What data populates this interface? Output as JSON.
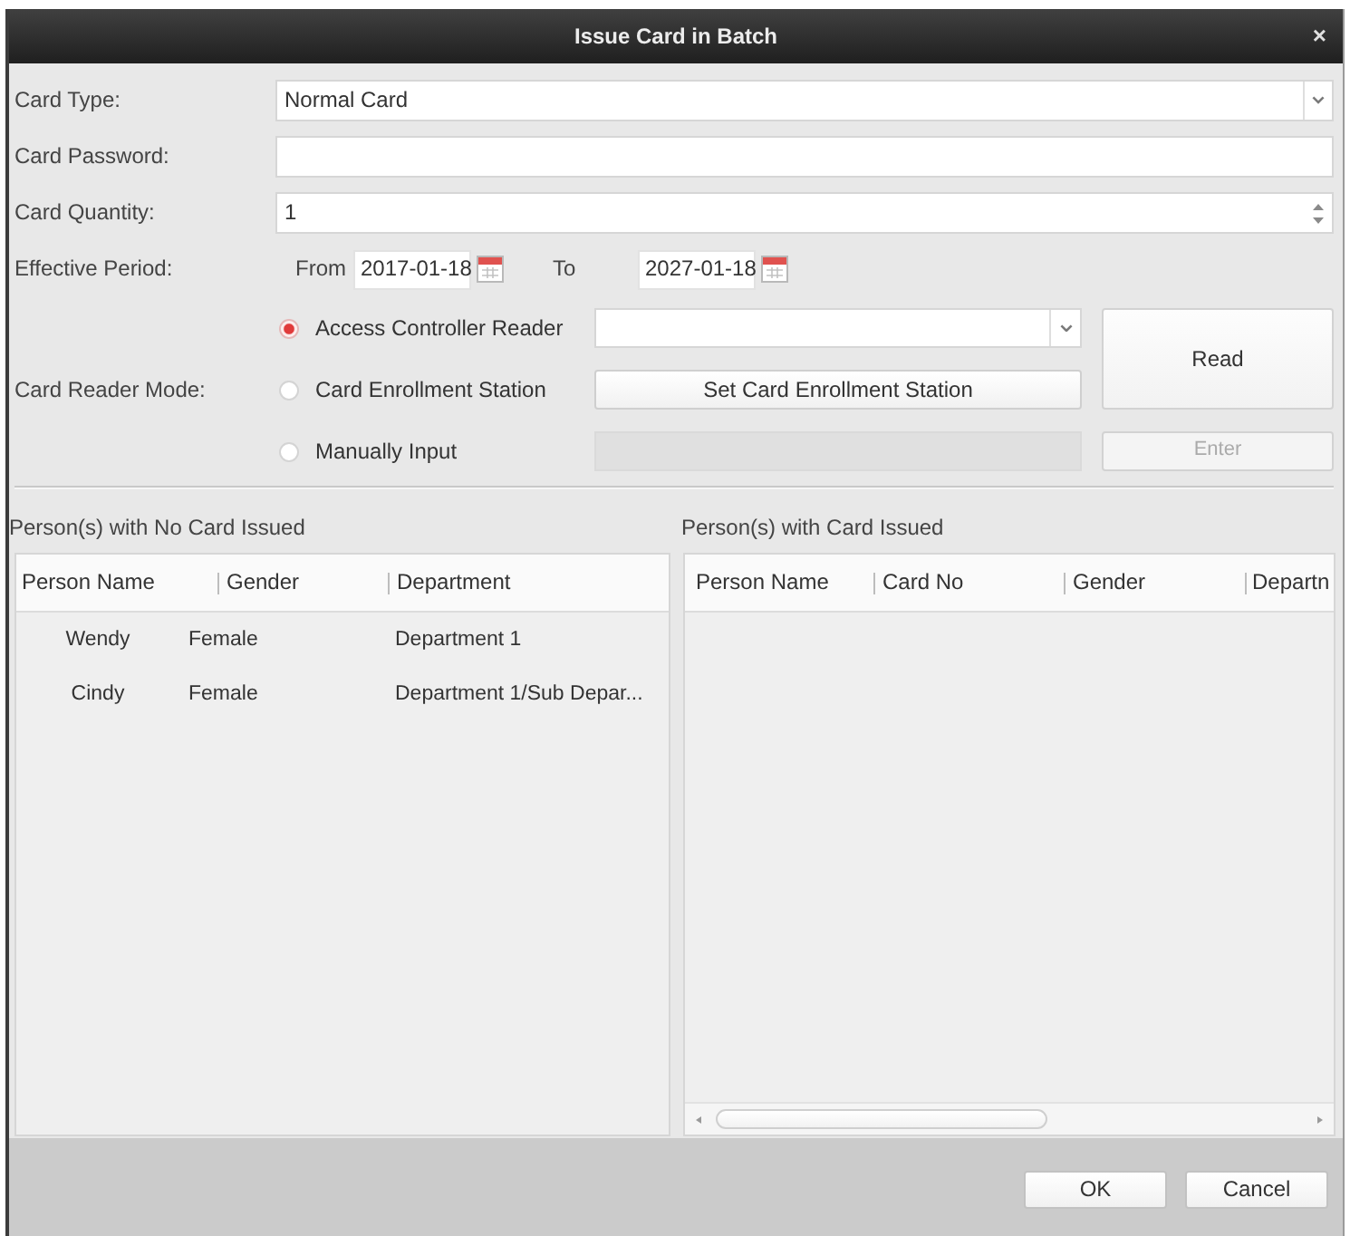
{
  "window": {
    "title": "Issue Card in Batch",
    "close": "×"
  },
  "card_type": {
    "label": "Card Type:",
    "value": "Normal Card"
  },
  "card_password": {
    "label": "Card Password:"
  },
  "card_quantity": {
    "label": "Card Quantity:",
    "value": "1"
  },
  "effective_period": {
    "label": "Effective Period:",
    "from_label": "From",
    "from": "2017-01-18",
    "to_label": "To",
    "to": "2027-01-18"
  },
  "card_reader_mode": {
    "label": "Card Reader Mode:",
    "options": [
      {
        "label": "Access Controller Reader",
        "selected": true,
        "kind": "dropdown"
      },
      {
        "label": "Card Enrollment Station",
        "selected": false,
        "kind": "button",
        "button": "Set Card Enrollment Station"
      },
      {
        "label": "Manually Input",
        "selected": false,
        "kind": "input",
        "disabled": true
      }
    ],
    "read_button": "Read",
    "enter_button": {
      "label": "Enter",
      "disabled": true
    }
  },
  "unissued": {
    "title": "Person(s) with No Card Issued",
    "columns": [
      "Person Name",
      "Gender",
      "Department"
    ],
    "rows": [
      [
        "Wendy",
        "Female",
        "Department 1"
      ],
      [
        "Cindy",
        "Female",
        "Department 1/Sub Depar..."
      ]
    ]
  },
  "issued": {
    "title": "Person(s) with Card Issued",
    "columns": [
      "Person Name",
      "Card No",
      "Gender",
      "Departn"
    ]
  },
  "buttons": [
    "OK",
    "Cancel"
  ]
}
